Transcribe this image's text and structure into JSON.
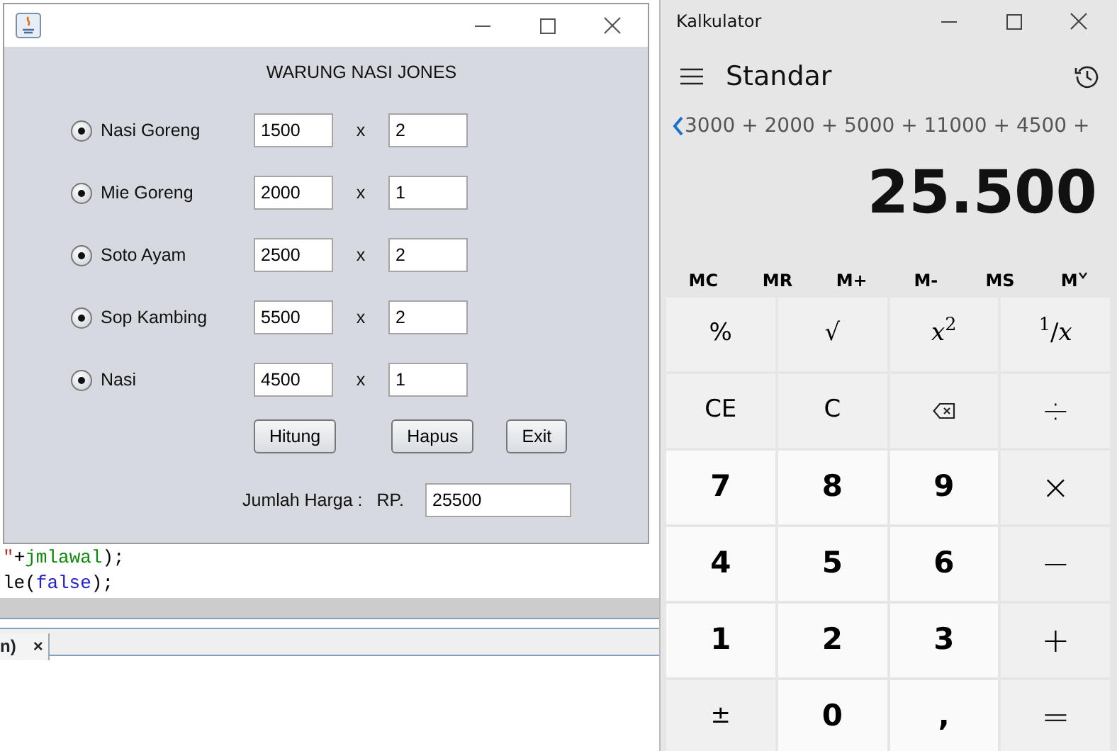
{
  "background_editor": {
    "code_lines": [
      {
        "tokens": [
          {
            "text": "\"",
            "kind": "string"
          },
          {
            "text": "+",
            "kind": "plain"
          },
          {
            "text": "jmlawal",
            "kind": "field"
          },
          {
            "text": ");",
            "kind": "plain"
          }
        ]
      },
      {
        "tokens": [
          {
            "text": "le(",
            "kind": "plain"
          },
          {
            "text": "false",
            "kind": "keyword"
          },
          {
            "text": ");",
            "kind": "plain"
          }
        ]
      }
    ],
    "output_tab": {
      "label": "n)",
      "close": "×"
    }
  },
  "java_window": {
    "heading": "WARUNG NASI JONES",
    "items": [
      {
        "name": "Nasi Goreng",
        "selected": true,
        "price": "1500",
        "times": "x",
        "qty": "2"
      },
      {
        "name": "Mie Goreng",
        "selected": true,
        "price": "2000",
        "times": "x",
        "qty": "1"
      },
      {
        "name": "Soto Ayam",
        "selected": true,
        "price": "2500",
        "times": "x",
        "qty": "2"
      },
      {
        "name": "Sop Kambing",
        "selected": true,
        "price": "5500",
        "times": "x",
        "qty": "2"
      },
      {
        "name": "Nasi",
        "selected": true,
        "price": "4500",
        "times": "x",
        "qty": "1"
      }
    ],
    "buttons": [
      "Hitung",
      "Hapus",
      "Exit"
    ],
    "total": {
      "label": "Jumlah Harga :",
      "currency": "RP.",
      "value": "25500"
    }
  },
  "calculator": {
    "title": "Kalkulator",
    "mode": "Standar",
    "expression": "3000 + 2000 + 5000 + 11000 + 4500 +",
    "result": "25.500",
    "memory": [
      {
        "label": "MC",
        "kind": "plain"
      },
      {
        "label": "MR",
        "kind": "plain"
      },
      {
        "label": "M+",
        "kind": "plain"
      },
      {
        "label": "M-",
        "kind": "plain"
      },
      {
        "label": "MS",
        "kind": "plain"
      },
      {
        "label": "M",
        "kind": "dropdown"
      }
    ],
    "keys": [
      {
        "label": "%",
        "kind": "function"
      },
      {
        "label": "√",
        "kind": "function"
      },
      {
        "label": "*x*$^{2}$",
        "kind": "function"
      },
      {
        "label": "$^{1}$/*x*",
        "kind": "function"
      },
      {
        "label": "CE",
        "kind": "function"
      },
      {
        "label": "C",
        "kind": "function"
      },
      {
        "kind": "backspace"
      },
      {
        "label": "÷",
        "kind": "operator"
      },
      {
        "label": "7",
        "kind": "digit"
      },
      {
        "label": "8",
        "kind": "digit"
      },
      {
        "label": "9",
        "kind": "digit"
      },
      {
        "label": "×",
        "kind": "operator"
      },
      {
        "label": "4",
        "kind": "digit"
      },
      {
        "label": "5",
        "kind": "digit"
      },
      {
        "label": "6",
        "kind": "digit"
      },
      {
        "label": "−",
        "kind": "operator"
      },
      {
        "label": "1",
        "kind": "digit"
      },
      {
        "label": "2",
        "kind": "digit"
      },
      {
        "label": "3",
        "kind": "digit"
      },
      {
        "label": "+",
        "kind": "operator"
      },
      {
        "label": "±",
        "kind": "function"
      },
      {
        "label": "0",
        "kind": "digit"
      },
      {
        "label": ",",
        "kind": "digit"
      },
      {
        "label": "=",
        "kind": "operator"
      }
    ]
  }
}
